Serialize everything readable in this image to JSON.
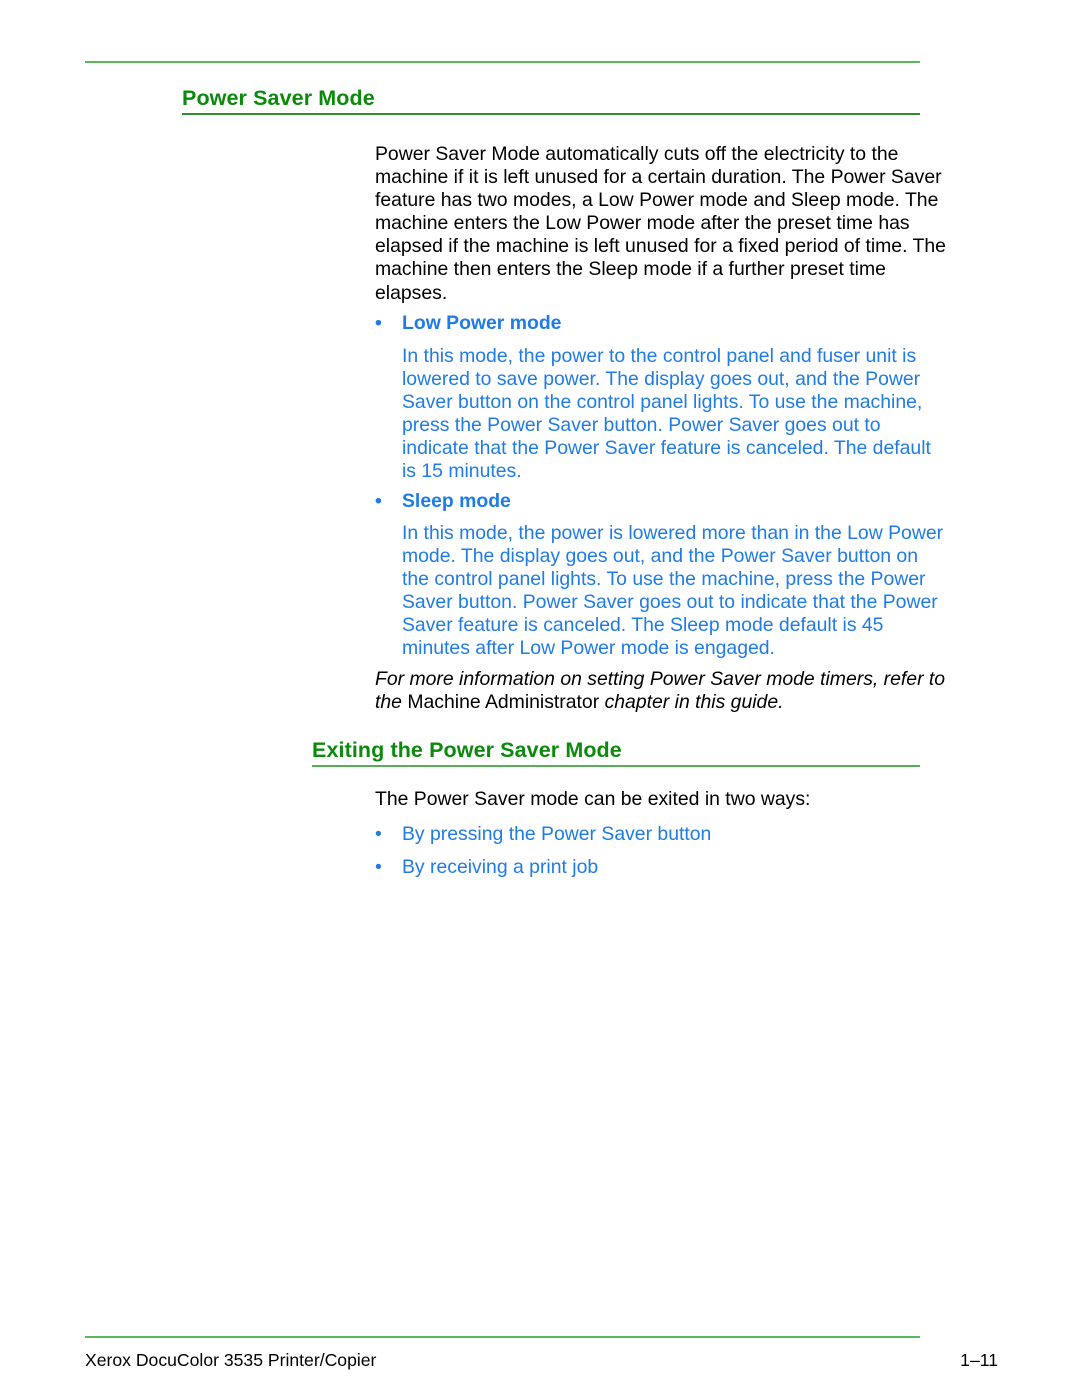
{
  "colors": {
    "heading_green": "#0b8a0b",
    "rule_green_light": "#5cb85c",
    "rule_green_dark": "#2f8f2f",
    "body_black": "#000000",
    "body_blue": "#1f7ce6",
    "page_background": "#ffffff"
  },
  "sections": {
    "power_saver": {
      "heading": "Power Saver Mode",
      "intro": "Power Saver Mode automatically cuts off the electricity to the machine if it is left unused for a certain duration. The Power Saver feature has two modes, a Low Power mode and Sleep mode. The machine enters the Low Power mode after the preset time has elapsed if the machine is left unused for a fixed period of time. The machine then enters the Sleep mode if a further preset time elapses.",
      "bullets": [
        {
          "marker": "•",
          "title": "Low Power mode",
          "body": "In this mode, the power to the control panel and fuser unit is lowered to save power. The display goes out, and the Power Saver button on the control panel lights. To use the machine, press the Power Saver button. Power Saver goes out to indicate that the Power Saver feature is canceled. The default is 15 minutes."
        },
        {
          "marker": "•",
          "title": "Sleep mode",
          "body": "In this mode, the power is lowered more than in the Low Power mode. The display goes out, and the Power Saver button on the control panel lights. To use the machine, press the Power Saver button. Power Saver goes out to indicate that the Power Saver feature is canceled. The Sleep mode default is 45 minutes after Low Power mode is engaged."
        }
      ],
      "note": {
        "part1": "For more information on setting Power Saver mode timers, refer to the ",
        "upright": "Machine Administrator",
        "part2": " chapter in this guide."
      }
    },
    "exiting": {
      "heading": "Exiting the Power Saver Mode",
      "intro": "The Power Saver mode can be exited in two ways:",
      "items": [
        {
          "marker": "•",
          "label": "By pressing the Power Saver button"
        },
        {
          "marker": "•",
          "label": "By receiving a print job"
        }
      ]
    }
  },
  "footer": {
    "product": "Xerox DocuColor 3535 Printer/Copier",
    "page_number": "1–11"
  }
}
